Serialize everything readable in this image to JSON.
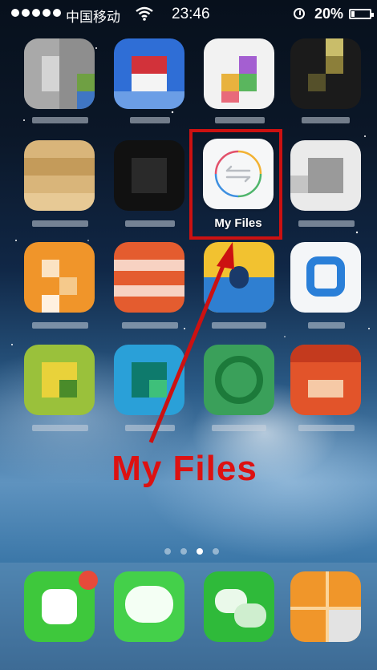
{
  "status_bar": {
    "carrier": "中国移动",
    "time": "23:46",
    "battery_percent": "20%",
    "battery_level": 0.2
  },
  "highlighted_app": {
    "label": "My Files",
    "icon": "transfer-arrows-icon"
  },
  "annotation": {
    "text": "My Files",
    "color": "#dd1111"
  },
  "pagination": {
    "total_pages": 4,
    "current_page": 3
  },
  "colors": {
    "highlight": "#cc1111"
  }
}
